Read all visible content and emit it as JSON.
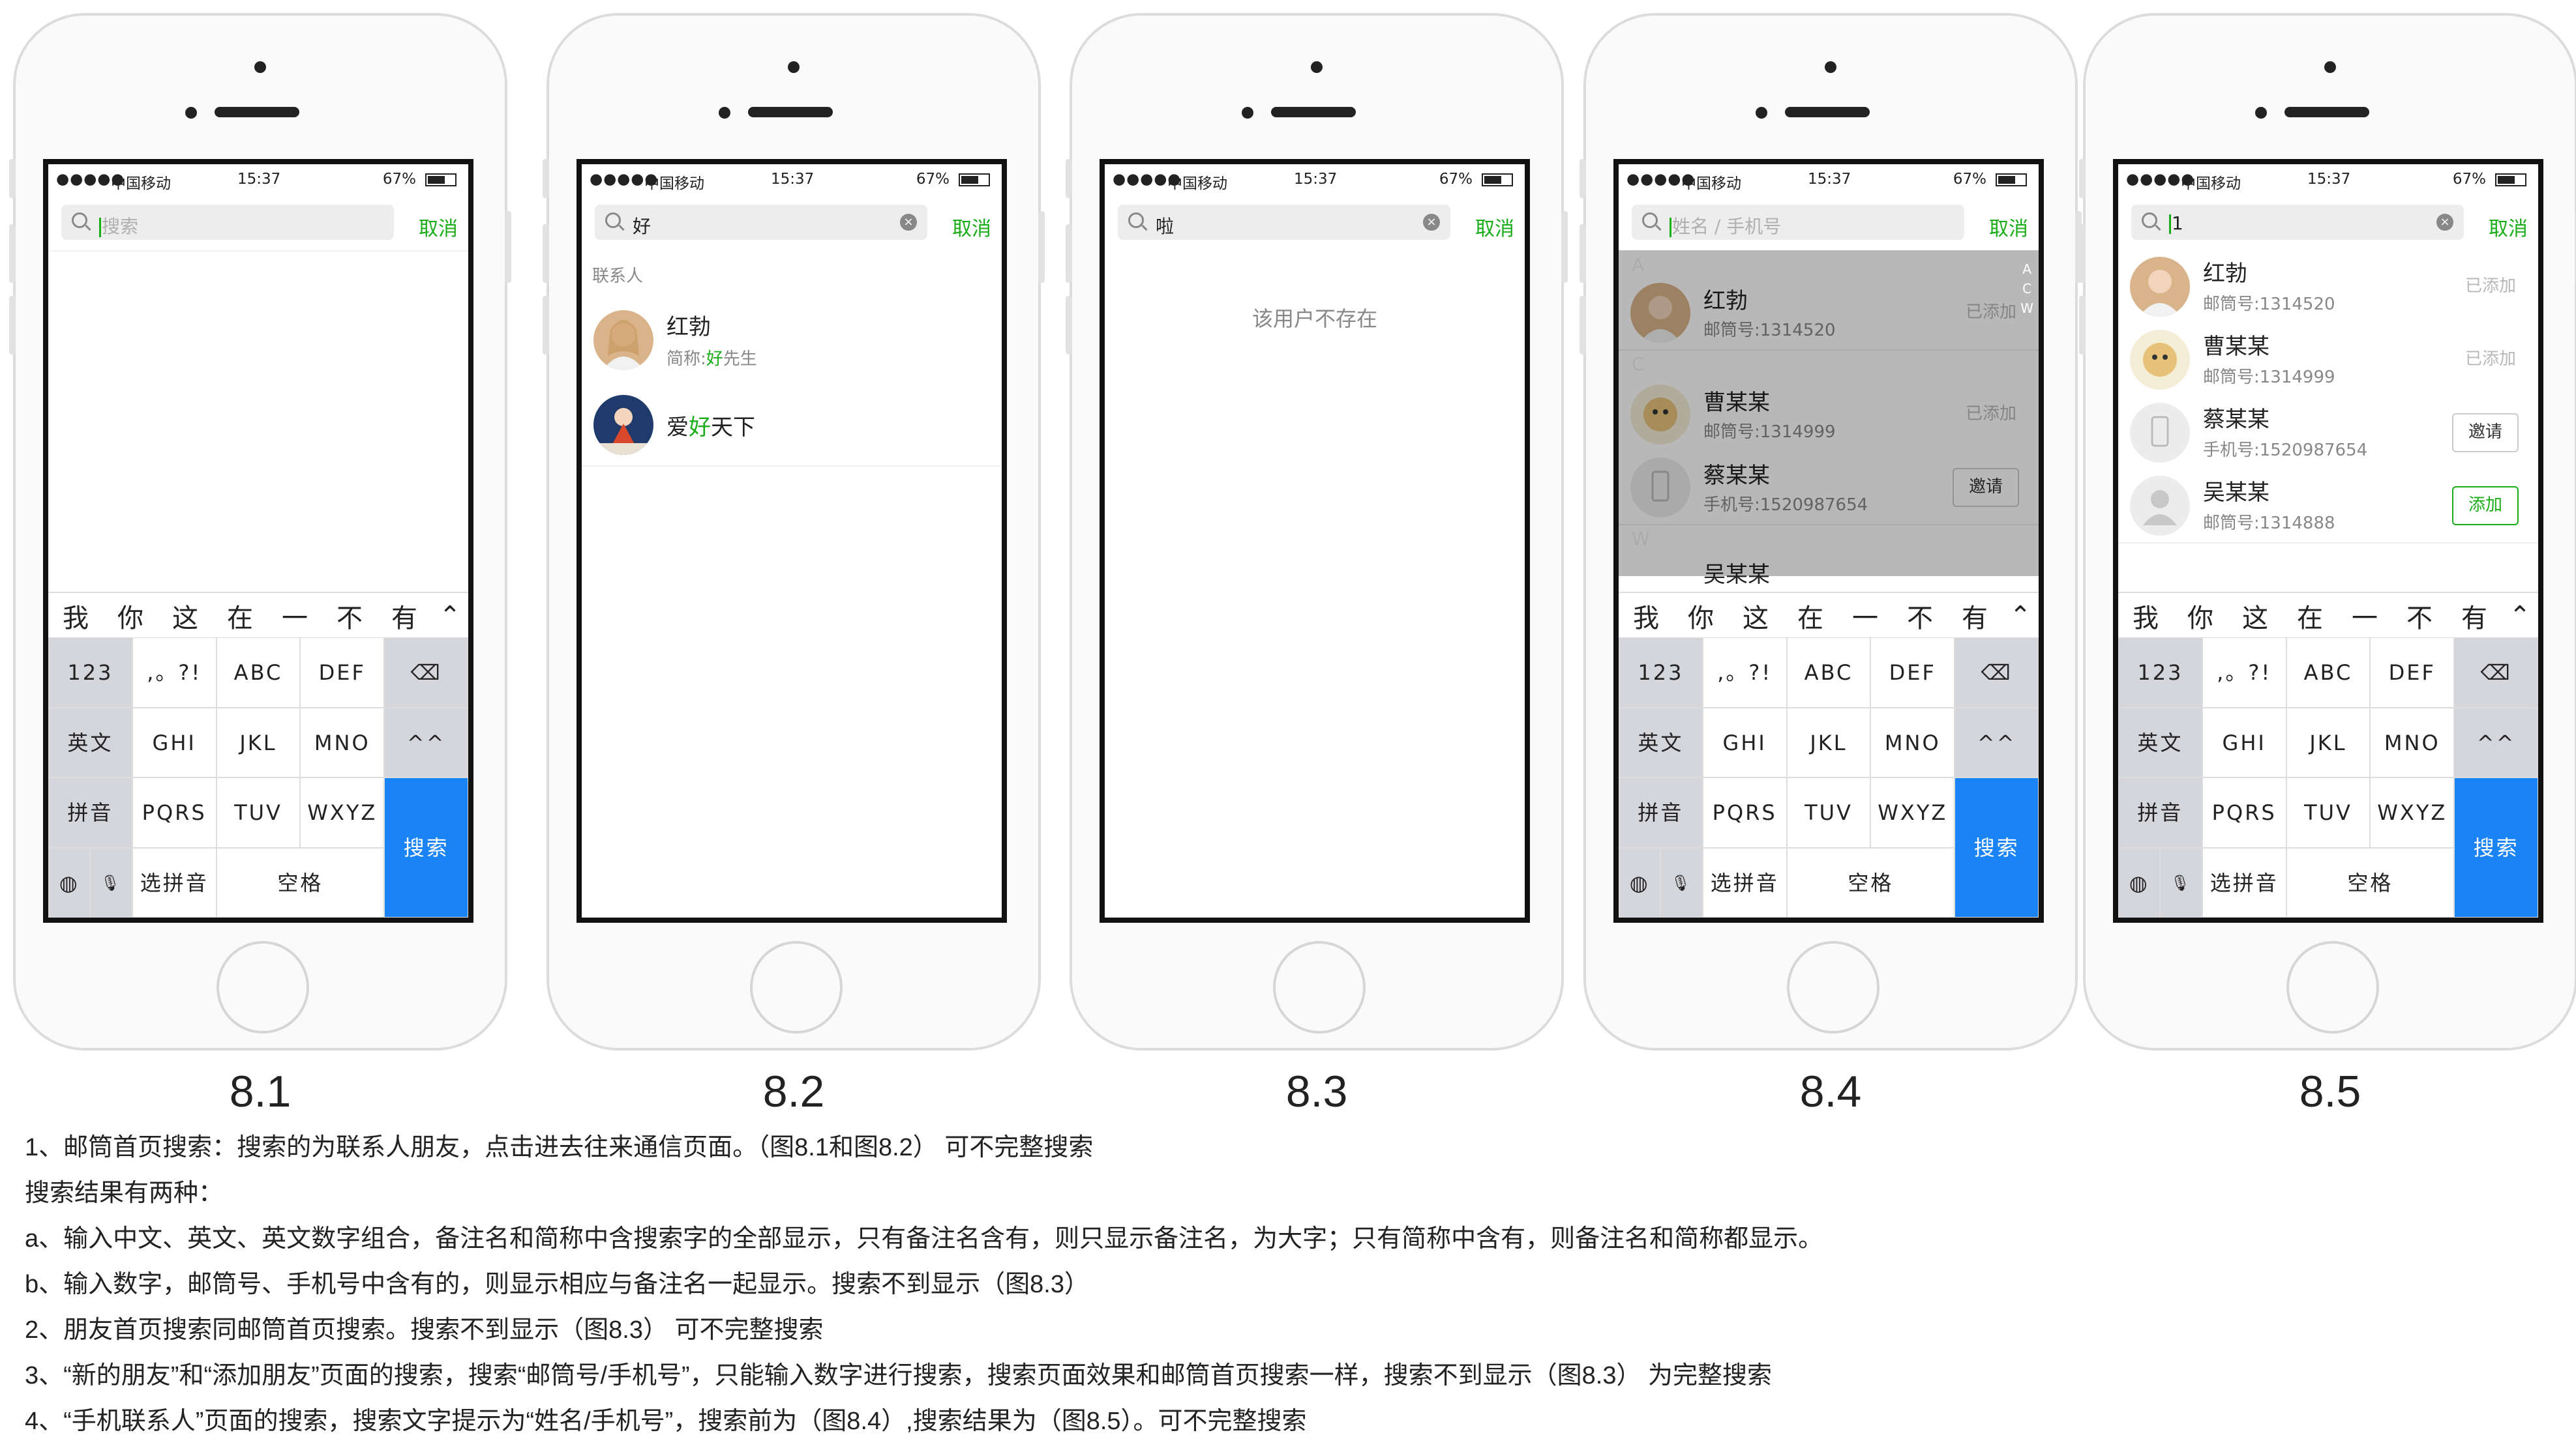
{
  "status": {
    "signal": "●●●●●",
    "carrier": "中国移动",
    "time": "15:37",
    "battery": "67%"
  },
  "cancel_label": "取消",
  "keyboard": {
    "candidates": [
      "我",
      "你",
      "这",
      "在",
      "一",
      "不",
      "有"
    ],
    "keys": {
      "num": "123",
      "punct": ",。?!",
      "abc": "ABC",
      "def": "DEF",
      "eng": "英文",
      "ghi": "GHI",
      "jkl": "JKL",
      "mno": "MNO",
      "emoji": "^^",
      "pinyin": "拼音",
      "pqrs": "PQRS",
      "tuv": "TUV",
      "wxyz": "WXYZ",
      "select": "选拼音",
      "space": "空格",
      "search": "搜索"
    }
  },
  "screens": [
    {
      "caption": "8.1",
      "search_placeholder": "搜索",
      "search_value": ""
    },
    {
      "caption": "8.2",
      "search_value": "好",
      "section": "联系人",
      "results": [
        {
          "name": "红勃",
          "sub_prefix": "简称:",
          "sub_hl": "好",
          "sub_suffix": "先生"
        },
        {
          "name_prefix": "爱",
          "name_hl": "好",
          "name_suffix": "天下"
        }
      ]
    },
    {
      "caption": "8.3",
      "search_value": "啦",
      "empty_text": "该用户不存在"
    },
    {
      "caption": "8.4",
      "search_placeholder": "姓名 / 手机号",
      "search_value": "",
      "index": [
        "A",
        "C",
        "W"
      ],
      "sections": [
        "A",
        "C",
        "W"
      ],
      "contacts": [
        {
          "name": "红勃",
          "sub": "邮筒号:1314520",
          "action": "已添加"
        },
        {
          "name": "曹某某",
          "sub": "邮筒号:1314999",
          "action": "已添加"
        },
        {
          "name": "蔡某某",
          "sub": "手机号:1520987654",
          "action": "邀请"
        },
        {
          "name": "吴某某"
        }
      ]
    },
    {
      "caption": "8.5",
      "search_value": "1",
      "contacts": [
        {
          "name": "红勃",
          "sub": "邮筒号:1314520",
          "action": "已添加"
        },
        {
          "name": "曹某某",
          "sub": "邮筒号:1314999",
          "action": "已添加"
        },
        {
          "name": "蔡某某",
          "sub": "手机号:1520987654",
          "action": "邀请"
        },
        {
          "name": "吴某某",
          "sub": "邮筒号:1314888",
          "action": "添加"
        }
      ]
    }
  ],
  "notes": [
    "1、邮筒首页搜索：搜索的为联系人朋友，点击进去往来通信页面。（图8.1和图8.2）     可不完整搜索",
    "搜索结果有两种：",
    "a、输入中文、英文、英文数字组合，备注名和简称中含搜索字的全部显示，只有备注名含有，则只显示备注名，为大字；只有简称中含有，则备注名和简称都显示。",
    "b、输入数字，邮筒号、手机号中含有的，则显示相应与备注名一起显示。搜索不到显示（图8.3）",
    "2、朋友首页搜索同邮筒首页搜索。搜索不到显示（图8.3）      可不完整搜索",
    "3、“新的朋友”和“添加朋友”页面的搜索，搜索“邮筒号/手机号”，只能输入数字进行搜索，搜索页面效果和邮筒首页搜索一样，搜索不到显示（图8.3）    为完整搜索",
    "4、“手机联系人”页面的搜索，搜索文字提示为“姓名/手机号”，搜索前为（图8.4）,搜索结果为（图8.5）。可不完整搜索"
  ]
}
